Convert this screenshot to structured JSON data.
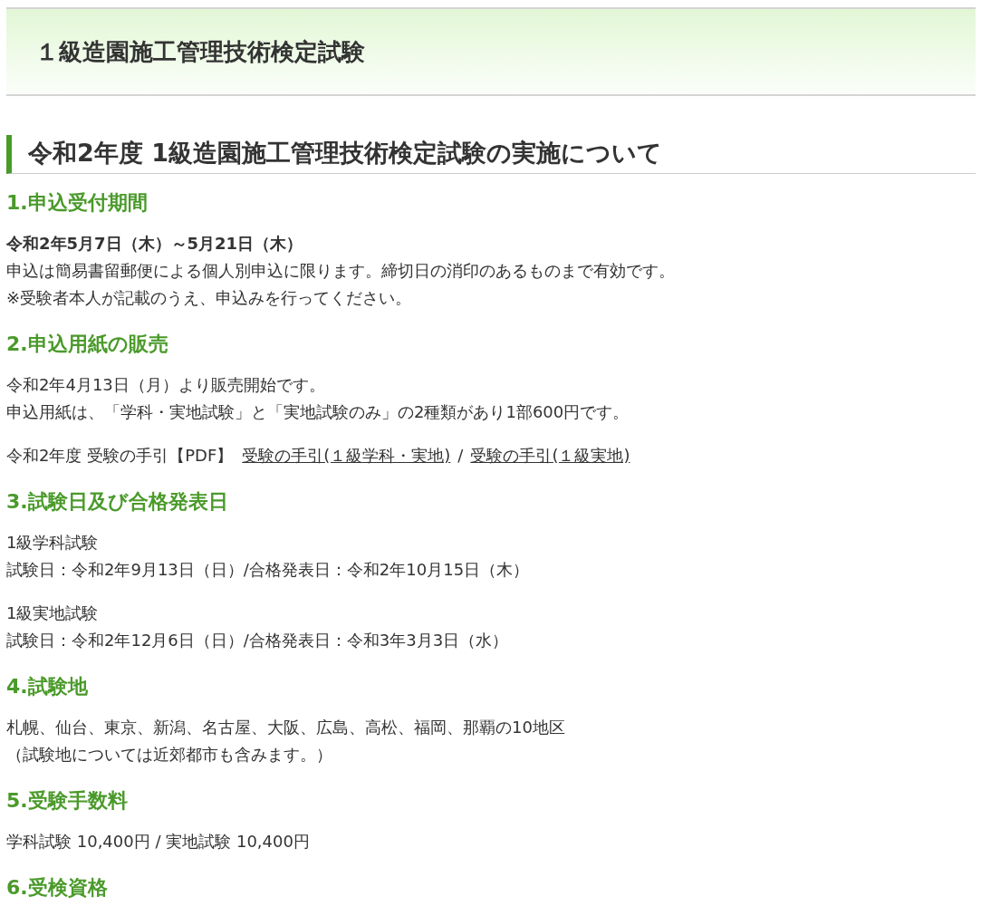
{
  "page_header": {
    "title": "１級造園施工管理技術検定試験"
  },
  "article_title": "令和2年度 1級造園施工管理技術検定試験の実施について",
  "sections": [
    {
      "heading": "1.申込受付期間",
      "blocks": [
        {
          "kind": "para",
          "lines": [
            {
              "kind": "strong",
              "text": "令和2年5月7日（木）～5月21日（木）"
            },
            {
              "kind": "plain",
              "text": "申込は簡易書留郵便による個人別申込に限ります。締切日の消印のあるものまで有効です。"
            },
            {
              "kind": "plain",
              "text": "※受験者本人が記載のうえ、申込みを行ってください。"
            }
          ]
        }
      ]
    },
    {
      "heading": "2.申込用紙の販売",
      "blocks": [
        {
          "kind": "para",
          "lines": [
            {
              "kind": "plain",
              "text": "令和2年4月13日（月）より販売開始です。"
            },
            {
              "kind": "plain",
              "text": "申込用紙は、「学科・実地試験」と「実地試験のみ」の2種類があり1部600円です。"
            }
          ]
        },
        {
          "kind": "links",
          "prefix": "令和2年度 受験の手引【PDF】",
          "separator": "/",
          "links": [
            "受験の手引(１級学科・実地)",
            "受験の手引(１級実地)"
          ]
        }
      ]
    },
    {
      "heading": "3.試験日及び合格発表日",
      "blocks": [
        {
          "kind": "para",
          "lines": [
            {
              "kind": "plain",
              "text": "1級学科試験"
            },
            {
              "kind": "plain",
              "text": "試験日：令和2年9月13日（日）/合格発表日：令和2年10月15日（木）"
            }
          ]
        },
        {
          "kind": "para",
          "lines": [
            {
              "kind": "plain",
              "text": "1級実地試験"
            },
            {
              "kind": "plain",
              "text": "試験日：令和2年12月6日（日）/合格発表日：令和3年3月3日（水）"
            }
          ]
        }
      ]
    },
    {
      "heading": "4.試験地",
      "blocks": [
        {
          "kind": "para",
          "lines": [
            {
              "kind": "plain",
              "text": "札幌、仙台、東京、新潟、名古屋、大阪、広島、高松、福岡、那覇の10地区"
            },
            {
              "kind": "plain",
              "text": "（試験地については近郊都市も含みます。）"
            }
          ]
        }
      ]
    },
    {
      "heading": "5.受験手数料",
      "blocks": [
        {
          "kind": "para",
          "lines": [
            {
              "kind": "plain",
              "text": "学科試験 10,400円 / 実地試験 10,400円"
            }
          ]
        }
      ]
    },
    {
      "heading": "6.受検資格"
    }
  ]
}
